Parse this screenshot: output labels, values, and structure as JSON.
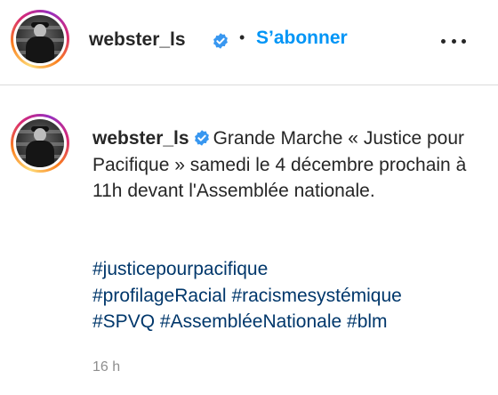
{
  "header": {
    "username": "webster_ls",
    "separator": "•",
    "follow_label": "S’abonner",
    "more_icon": "more-horizontal-icon"
  },
  "caption": {
    "username": "webster_ls",
    "text": "Grande Marche « Justice pour Pacifique » samedi le 4 décembre prochain à 11h devant l'Assemblée nationale.",
    "hashtags": [
      "#justicepourpacifique",
      "#profilageRacial",
      "#racismesystémique",
      "#SPVQ",
      "#AssembléeNationale",
      "#blm"
    ],
    "timestamp": "16 h"
  },
  "colors": {
    "follow": "#0095f6",
    "hashtag": "#00376b",
    "verified": "#3897f0",
    "timestamp": "#8e8e8e"
  }
}
